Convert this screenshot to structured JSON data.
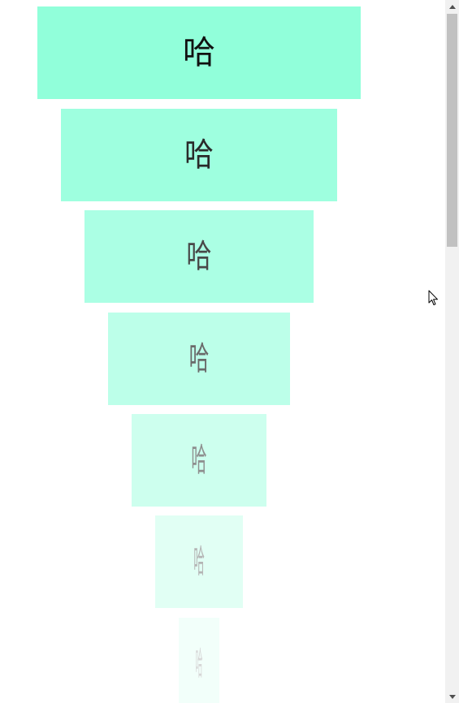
{
  "boxes": [
    {
      "label": "哈",
      "bg": "#91ffda",
      "fg": "#111111"
    },
    {
      "label": "哈",
      "bg": "#9effdf",
      "fg": "#2a2a2a"
    },
    {
      "label": "哈",
      "bg": "#abffe4",
      "fg": "#484848"
    },
    {
      "label": "哈",
      "bg": "#bcffe9",
      "fg": "#6a6a6a"
    },
    {
      "label": "哈",
      "bg": "#cdffee",
      "fg": "#8e8e8e"
    },
    {
      "label": "哈",
      "bg": "#e1fff4",
      "fg": "#b4b4b4"
    },
    {
      "label": "哈",
      "bg": "#f2fffa",
      "fg": "#d6d6d6"
    }
  ],
  "icons": {
    "scroll_up": "triangle-up",
    "scroll_down": "triangle-down",
    "cursor": "arrow-pointer"
  }
}
